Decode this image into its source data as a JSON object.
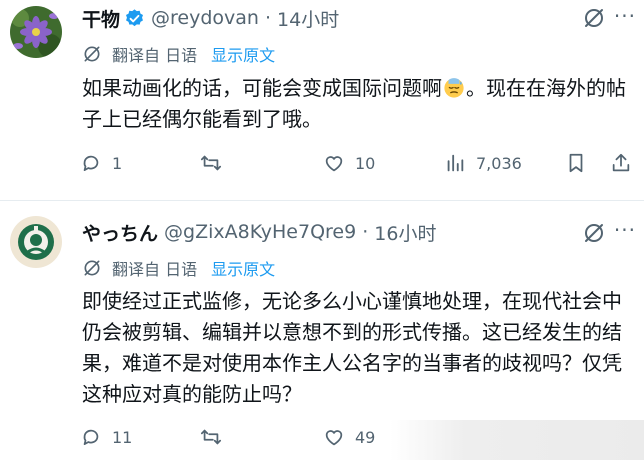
{
  "tweets": [
    {
      "name": "干物",
      "handle": "@reydovan",
      "separator": "·",
      "time": "14小时",
      "translated_label": "翻译自 日语",
      "show_original": "显示原文",
      "text_before_emoji": "如果动画化的话，可能会变成国际问题啊",
      "text_after_emoji": "。现在在海外的帖子上已经偶尔能看到了哦。",
      "emoji": "sweat-face-emoji",
      "verified": true,
      "replies": "1",
      "retweets": "",
      "likes": "10",
      "views": "7,036"
    },
    {
      "name": "やっちん",
      "handle": "@gZixA8KyHe7Qre9",
      "separator": "·",
      "time": "16小时",
      "translated_label": "翻译自 日语",
      "show_original": "显示原文",
      "text": "即使经过正式监修，无论多么小心谨慎地处理，在现代社会中仍会被剪辑、编辑并以意想不到的形式传播。这已经发生的结果，难道不是对使用本作主人公名字的当事者的歧视吗？仅凭这种应对真的能防止吗？",
      "verified": false,
      "replies": "11",
      "retweets": "",
      "likes": "49"
    }
  ],
  "more_glyph": "···",
  "colors": {
    "accent": "#1d9bf0",
    "muted": "#536471",
    "text": "#0f1419"
  }
}
